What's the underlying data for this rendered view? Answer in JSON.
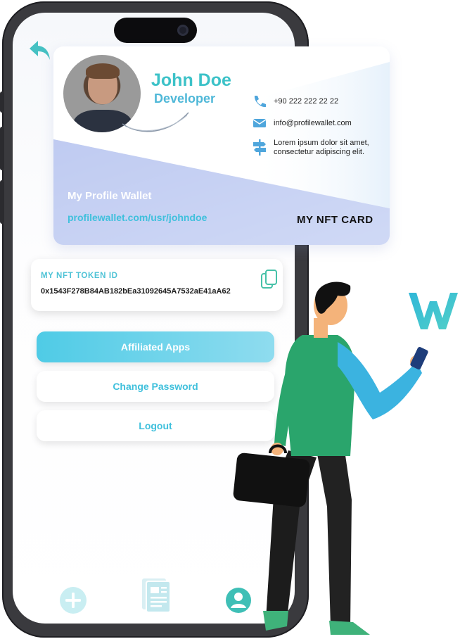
{
  "profile": {
    "name": "John Doe",
    "role": "Developer",
    "phone": "+90 222 222 22 22",
    "email": "info@profilewallet.com",
    "address_line1": "Lorem ipsum dolor sit amet,",
    "address_line2": "consectetur adipiscing elit.",
    "wallet_label": "My Profile Wallet",
    "wallet_url": "profilewallet.com/usr/johndoe",
    "card_label": "MY NFT CARD"
  },
  "token": {
    "title": "MY NFT TOKEN ID",
    "value": "0x1543F278B84AB182bEa31092645A7532aE41aA62"
  },
  "menu": {
    "affiliated": "Affiliated Apps",
    "change_password": "Change Password",
    "logout": "Logout"
  },
  "icons": {
    "back": "back-arrow-icon",
    "copy": "copy-icon",
    "phone": "phone-icon",
    "email": "envelope-icon",
    "address": "signpost-icon",
    "add": "plus-circle-icon",
    "document": "document-icon",
    "profile": "user-circle-icon"
  },
  "colors": {
    "accent": "#3cc2c8",
    "accent_blue": "#4fcbe6",
    "text_dark": "#111111"
  }
}
